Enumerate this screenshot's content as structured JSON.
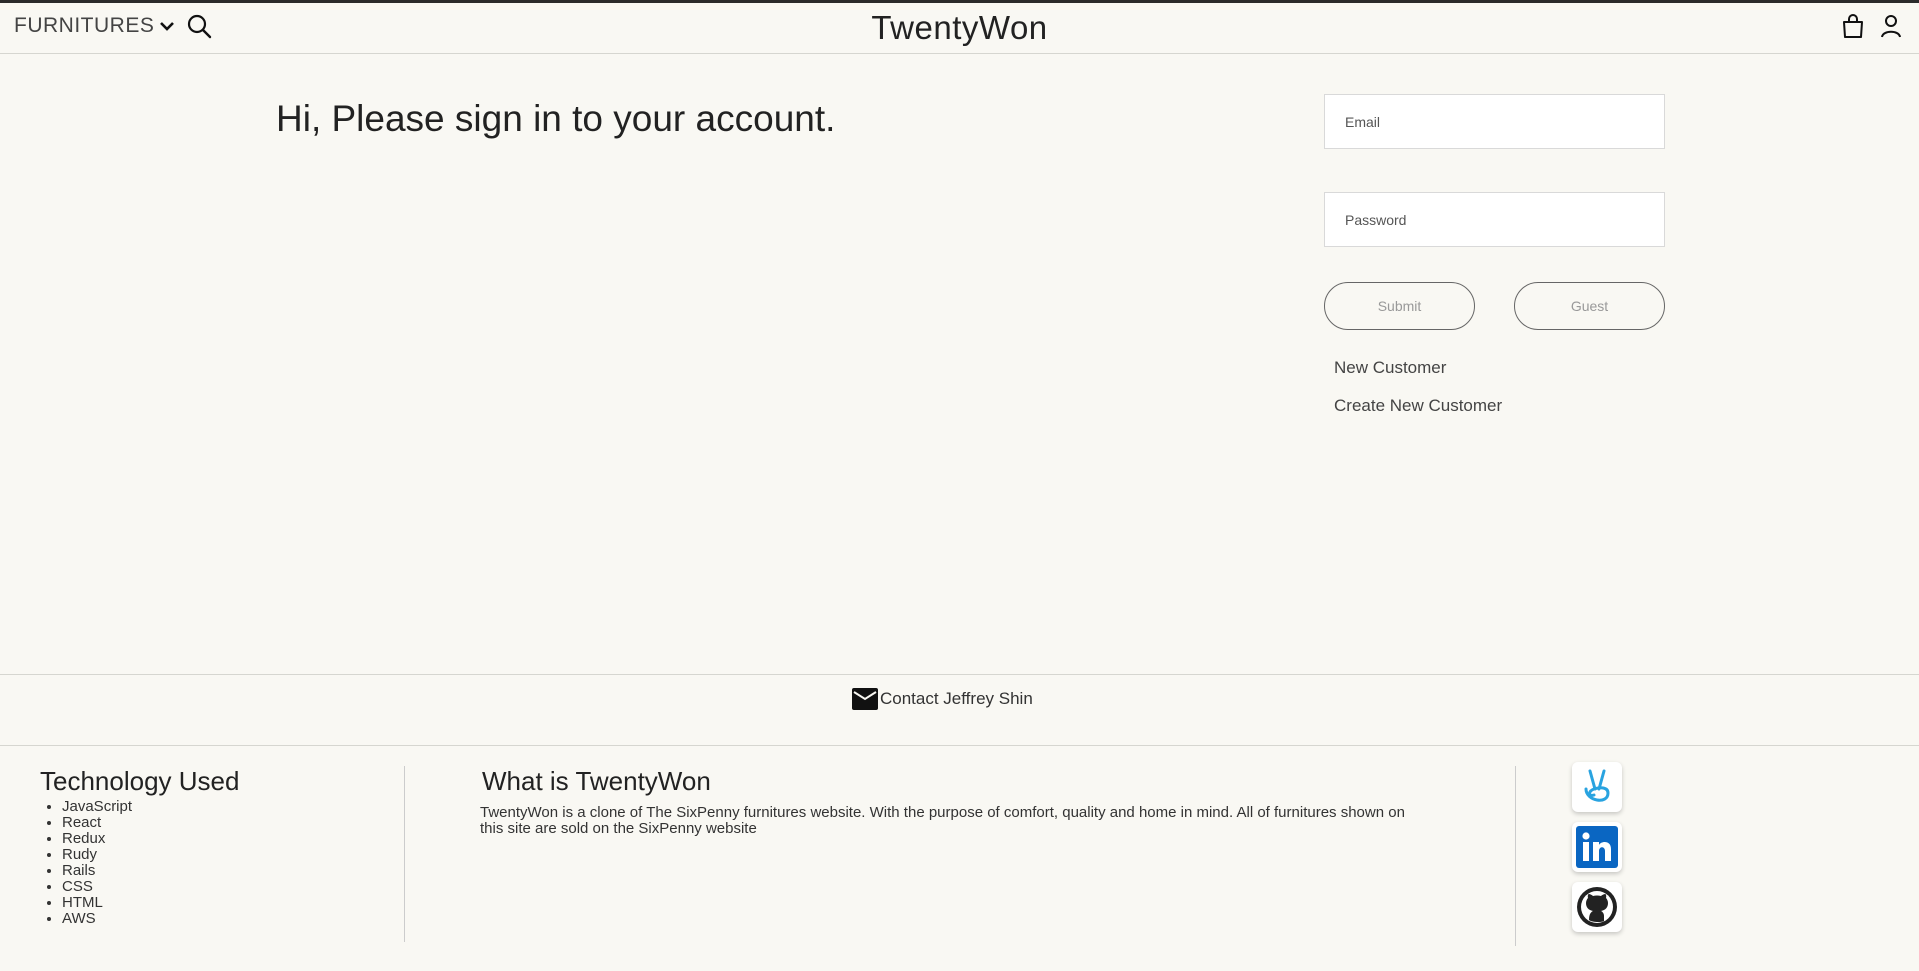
{
  "header": {
    "category_label": "FURNITURES",
    "brand": "TwentyWon"
  },
  "icons": {
    "dropdown": "chevron-down-icon",
    "search": "search-icon",
    "cart": "shopping-bag-icon",
    "account": "user-icon",
    "mail": "mail-icon",
    "angellist": "angellist-icon",
    "linkedin": "linkedin-icon",
    "github": "github-icon"
  },
  "signin": {
    "greeting": "Hi, Please sign in to your account.",
    "email_placeholder": "Email",
    "password_placeholder": "Password",
    "submit_label": "Submit",
    "guest_label": "Guest",
    "new_customer_label": "New Customer",
    "create_customer_label": "Create New Customer"
  },
  "contact": {
    "label": "Contact Jeffrey Shin"
  },
  "footer": {
    "tech_title": "Technology Used",
    "technologies": [
      "JavaScript",
      "React",
      "Redux",
      "Rudy",
      "Rails",
      "CSS",
      "HTML",
      "AWS"
    ],
    "about_title": "What is TwentyWon",
    "about_text": "TwentyWon is a clone of The SixPenny furnitures website. With the purpose of comfort, quality and home in mind. All of furnitures shown on this site are sold on the SixPenny website"
  },
  "colors": {
    "background": "#f9f8f3",
    "linkedin_blue": "#0a66c2",
    "angellist_blue": "#29a3e0"
  }
}
